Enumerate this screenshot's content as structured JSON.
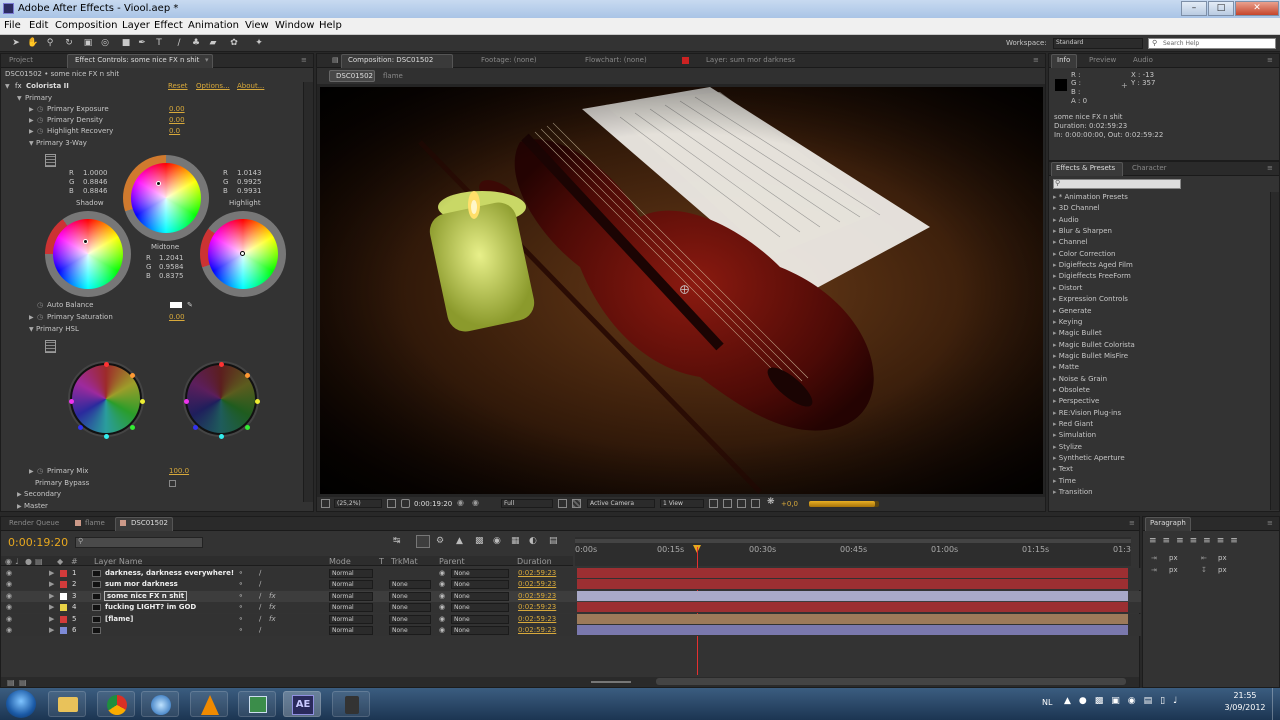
{
  "window": {
    "title": "Adobe After Effects - Viool.aep *"
  },
  "menu": [
    "File",
    "Edit",
    "Composition",
    "Layer",
    "Effect",
    "Animation",
    "View",
    "Window",
    "Help"
  ],
  "workspace": {
    "label": "Workspace:",
    "value": "Standard",
    "search_placeholder": "Search Help"
  },
  "effect_controls": {
    "tabs": {
      "project": "Project",
      "effect": "Effect Controls: some nice FX n shit"
    },
    "breadcrumb": "DSC01502 • some nice FX n shit",
    "effect_name": "Colorista II",
    "reset": "Reset",
    "options": "Options...",
    "about": "About...",
    "primary": "Primary",
    "exposure": {
      "label": "Primary Exposure",
      "value": "0.00"
    },
    "density": {
      "label": "Primary Density",
      "value": "0.00"
    },
    "highlight_recovery": {
      "label": "Highlight Recovery",
      "value": "0.0"
    },
    "three_way": "Primary 3-Way",
    "shadow": {
      "r": "1.0000",
      "g": "0.8846",
      "b": "0.8846",
      "label": "Shadow"
    },
    "highlight": {
      "r": "1.0143",
      "g": "0.9925",
      "b": "0.9931",
      "label": "Highlight"
    },
    "midtone": {
      "r": "1.2041",
      "g": "0.9584",
      "b": "0.8375",
      "label": "Midtone"
    },
    "rgb_labels": [
      "R",
      "G",
      "B"
    ],
    "auto_balance": "Auto Balance",
    "saturation": {
      "label": "Primary Saturation",
      "value": "0.00"
    },
    "hsl": "Primary HSL",
    "mix": {
      "label": "Primary Mix",
      "value": "100.0"
    },
    "bypass": "Primary Bypass",
    "secondary": "Secondary",
    "master": "Master"
  },
  "viewer": {
    "tabs": {
      "comp": "Composition: DSC01502",
      "footage": "Footage: (none)",
      "flowchart": "Flowchart: (none)",
      "layer": "Layer: sum mor darkness"
    },
    "subtabs": [
      "DSC01502",
      "flame"
    ],
    "zoom": "(25,2%)",
    "timecode": "0:00:19:20",
    "resolution": "Full",
    "camera": "Active Camera",
    "views": "1 View",
    "exposure": "+0,0"
  },
  "info": {
    "tabs": [
      "Info",
      "Preview",
      "Audio"
    ],
    "r": "R :",
    "g": "G :",
    "b": "B :",
    "a": "A : 0",
    "x": "X : -13",
    "y": "Y : 357",
    "layer": "some nice FX n shit",
    "duration": "Duration: 0:02:59:23",
    "inout": "In: 0:00:00:00, Out: 0:02:59:22"
  },
  "effects_presets": {
    "tabs": [
      "Effects & Presets",
      "Character"
    ],
    "items": [
      "* Animation Presets",
      "3D Channel",
      "Audio",
      "Blur & Sharpen",
      "Channel",
      "Color Correction",
      "Digieffects Aged Film",
      "Digieffects FreeForm",
      "Distort",
      "Expression Controls",
      "Generate",
      "Keying",
      "Magic Bullet",
      "Magic Bullet Colorista",
      "Magic Bullet MisFire",
      "Matte",
      "Noise & Grain",
      "Obsolete",
      "Perspective",
      "RE:Vision Plug-ins",
      "Red Giant",
      "Simulation",
      "Stylize",
      "Synthetic Aperture",
      "Text",
      "Time",
      "Transition"
    ]
  },
  "timeline": {
    "tabs": [
      "Render Queue",
      "flame",
      "DSC01502"
    ],
    "timecode": "0:00:19:20",
    "search_placeholder": "",
    "headers": {
      "num": "#",
      "layer_name": "Layer Name",
      "mode": "Mode",
      "t": "T",
      "trkmat": "TrkMat",
      "parent": "Parent",
      "duration": "Duration"
    },
    "ruler": [
      "0:00s",
      "00:15s",
      "00:30s",
      "00:45s",
      "01:00s",
      "01:15s",
      "01:3"
    ],
    "layers": [
      {
        "num": "1",
        "name": "darkness, darkness everywhere!",
        "mode": "Normal",
        "trkmat": "",
        "parent": "None",
        "duration": "0:02:59:23",
        "color": "#d23b3b",
        "bar": "#9c2f32"
      },
      {
        "num": "2",
        "name": "sum mor darkness",
        "mode": "Normal",
        "trkmat": "None",
        "parent": "None",
        "duration": "0:02:59:23",
        "color": "#d23b3b",
        "bar": "#9c2f32"
      },
      {
        "num": "3",
        "name": "some nice FX n shit",
        "mode": "Normal",
        "trkmat": "None",
        "parent": "None",
        "duration": "0:02:59:23",
        "color": "#ffffff",
        "bar": "#a9a9c8"
      },
      {
        "num": "4",
        "name": "fucking LIGHT? im GOD",
        "mode": "Normal",
        "trkmat": "None",
        "parent": "None",
        "duration": "0:02:59:23",
        "color": "#e8d246",
        "bar": "#9c2f32"
      },
      {
        "num": "5",
        "name": "[flame]",
        "mode": "Normal",
        "trkmat": "None",
        "parent": "None",
        "duration": "0:02:59:23",
        "color": "#d23b3b",
        "bar": "#9c7a5a"
      },
      {
        "num": "6",
        "name": "",
        "mode": "Normal",
        "trkmat": "None",
        "parent": "None",
        "duration": "0:02:59:23",
        "color": "#7d8ad6",
        "bar": "#7a78ad"
      }
    ]
  },
  "paragraph": {
    "tab": "Paragraph",
    "units": [
      "px",
      "px",
      "px",
      "px",
      "px"
    ]
  },
  "taskbar": {
    "lang": "NL",
    "time": "21:55",
    "date": "3/09/2012",
    "ae_label": "AE"
  }
}
